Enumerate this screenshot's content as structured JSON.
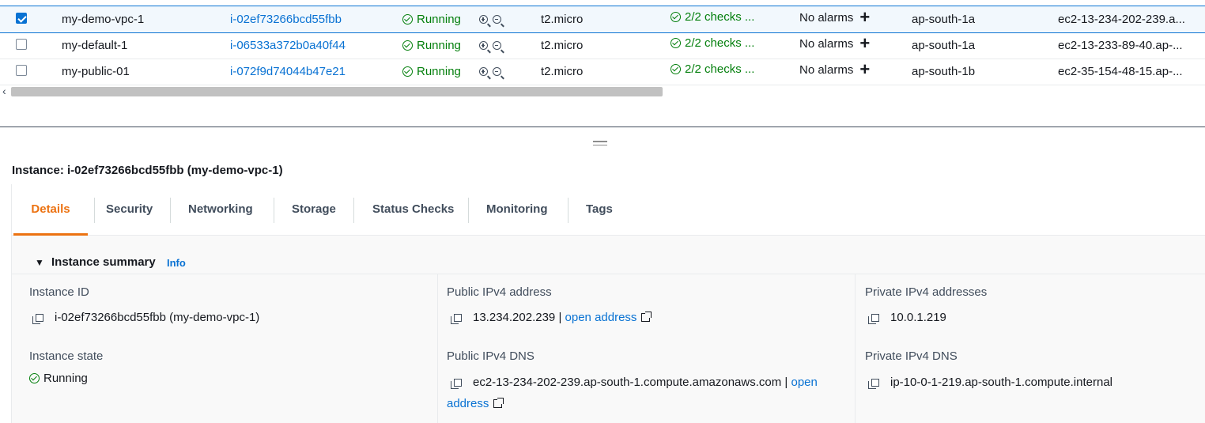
{
  "instances": [
    {
      "name": "my-demo-vpc-1",
      "id": "i-02ef73266bcd55fbb",
      "state": "Running",
      "type": "t2.micro",
      "checks": "2/2 checks ...",
      "alarms": "No alarms",
      "az": "ap-south-1a",
      "dns": "ec2-13-234-202-239.a...",
      "selected": true
    },
    {
      "name": "my-default-1",
      "id": "i-06533a372b0a40f44",
      "state": "Running",
      "type": "t2.micro",
      "checks": "2/2 checks ...",
      "alarms": "No alarms",
      "az": "ap-south-1a",
      "dns": "ec2-13-233-89-40.ap-...",
      "selected": false
    },
    {
      "name": "my-public-01",
      "id": "i-072f9d74044b47e21",
      "state": "Running",
      "type": "t2.micro",
      "checks": "2/2 checks ...",
      "alarms": "No alarms",
      "az": "ap-south-1b",
      "dns": "ec2-35-154-48-15.ap-...",
      "selected": false
    }
  ],
  "details": {
    "title": "Instance: i-02ef73266bcd55fbb (my-demo-vpc-1)",
    "tabs": [
      "Details",
      "Security",
      "Networking",
      "Storage",
      "Status Checks",
      "Monitoring",
      "Tags"
    ],
    "active_tab": "Details",
    "summary_title": "Instance summary",
    "info_link": "Info",
    "instance_id_label": "Instance ID",
    "instance_id_value": "i-02ef73266bcd55fbb (my-demo-vpc-1)",
    "public_ipv4_label": "Public IPv4 address",
    "public_ipv4_value": "13.234.202.239",
    "separator": "|",
    "open_address": "open address",
    "private_ipv4_label": "Private IPv4 addresses",
    "private_ipv4_value": "10.0.1.219",
    "instance_state_label": "Instance state",
    "instance_state_value": "Running",
    "public_dns_label": "Public IPv4 DNS",
    "public_dns_value": "ec2-13-234-202-239.ap-south-1.compute.amazonaws.com",
    "open_word": "open",
    "address_word": "address",
    "private_dns_label": "Private IPv4 DNS",
    "private_dns_value": "ip-10-0-1-219.ap-south-1.compute.internal"
  },
  "colors": {
    "link": "#0972d3",
    "running": "#037f0c",
    "active_tab": "#ec7211"
  }
}
